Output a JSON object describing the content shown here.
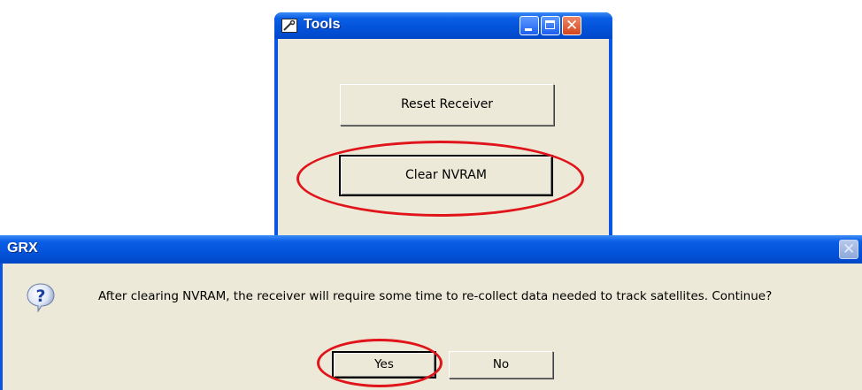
{
  "tools_window": {
    "title": "Tools",
    "icon": "wrench-tool-icon",
    "buttons": {
      "reset": "Reset Receiver",
      "clear": "Clear NVRAM"
    },
    "controls": [
      "minimize-icon",
      "maximize-icon",
      "close-icon"
    ]
  },
  "grx_dialog": {
    "title": "GRX",
    "icon": "question-icon",
    "message": "After clearing NVRAM, the receiver will require some time to re-collect data needed to track satellites. Continue?",
    "buttons": {
      "yes": "Yes",
      "no": "No"
    }
  },
  "colors": {
    "titlebar": "#0a54e6",
    "window_face": "#ece9d8",
    "close_button": "#d2451d",
    "annotation": "#e0141a"
  }
}
